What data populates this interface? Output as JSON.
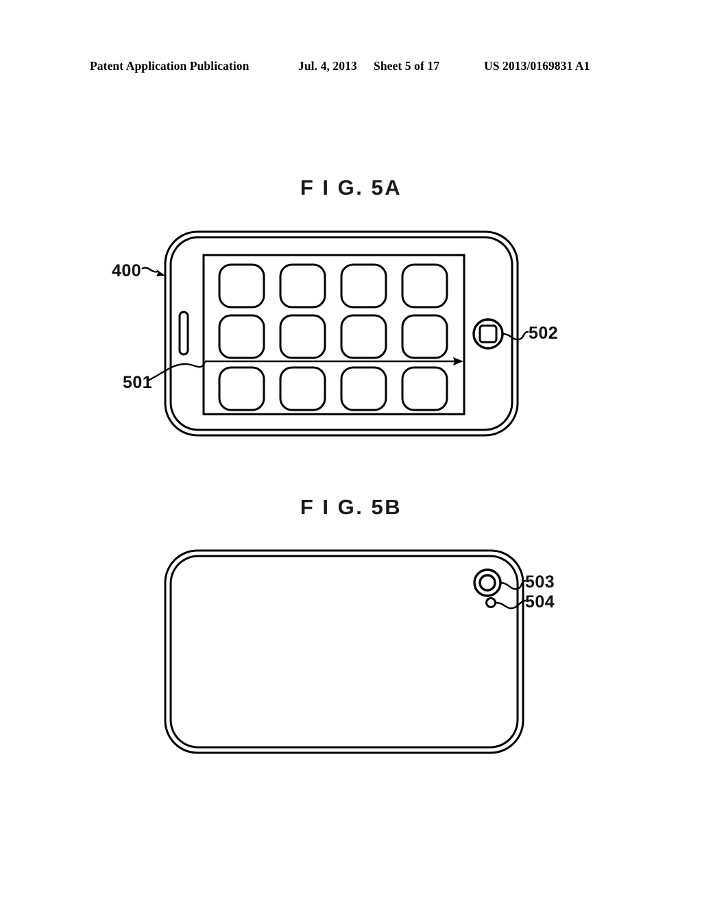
{
  "page": {
    "header": {
      "publication": "Patent Application Publication",
      "date": "Jul. 4, 2013",
      "sheet": "Sheet 5 of 17",
      "patent_number": "US 2013/0169831 A1"
    },
    "background_color": "#ffffff",
    "line_color": "#000000"
  },
  "figures": [
    {
      "id": "fig5a",
      "title": "F I G.  5A",
      "description": "Front view of portable device in landscape orientation showing touch screen with 4x3 grid of application icons, earpiece speaker slot, home button, and a horizontal swipe arrow",
      "reference_numerals": [
        {
          "id": "400",
          "label": "400",
          "target": "device-body"
        },
        {
          "id": "501",
          "label": "501",
          "target": "swipe-arrow"
        },
        {
          "id": "502",
          "label": "502",
          "target": "home-button"
        }
      ],
      "icon_grid": {
        "columns": 4,
        "rows": 3,
        "total_icons": 12
      }
    },
    {
      "id": "fig5b",
      "title": "F I G.  5B",
      "description": "Rear view of portable device showing camera lens and flash in upper right corner",
      "reference_numerals": [
        {
          "id": "503",
          "label": "503",
          "target": "camera-lens"
        },
        {
          "id": "504",
          "label": "504",
          "target": "camera-flash"
        }
      ]
    }
  ]
}
